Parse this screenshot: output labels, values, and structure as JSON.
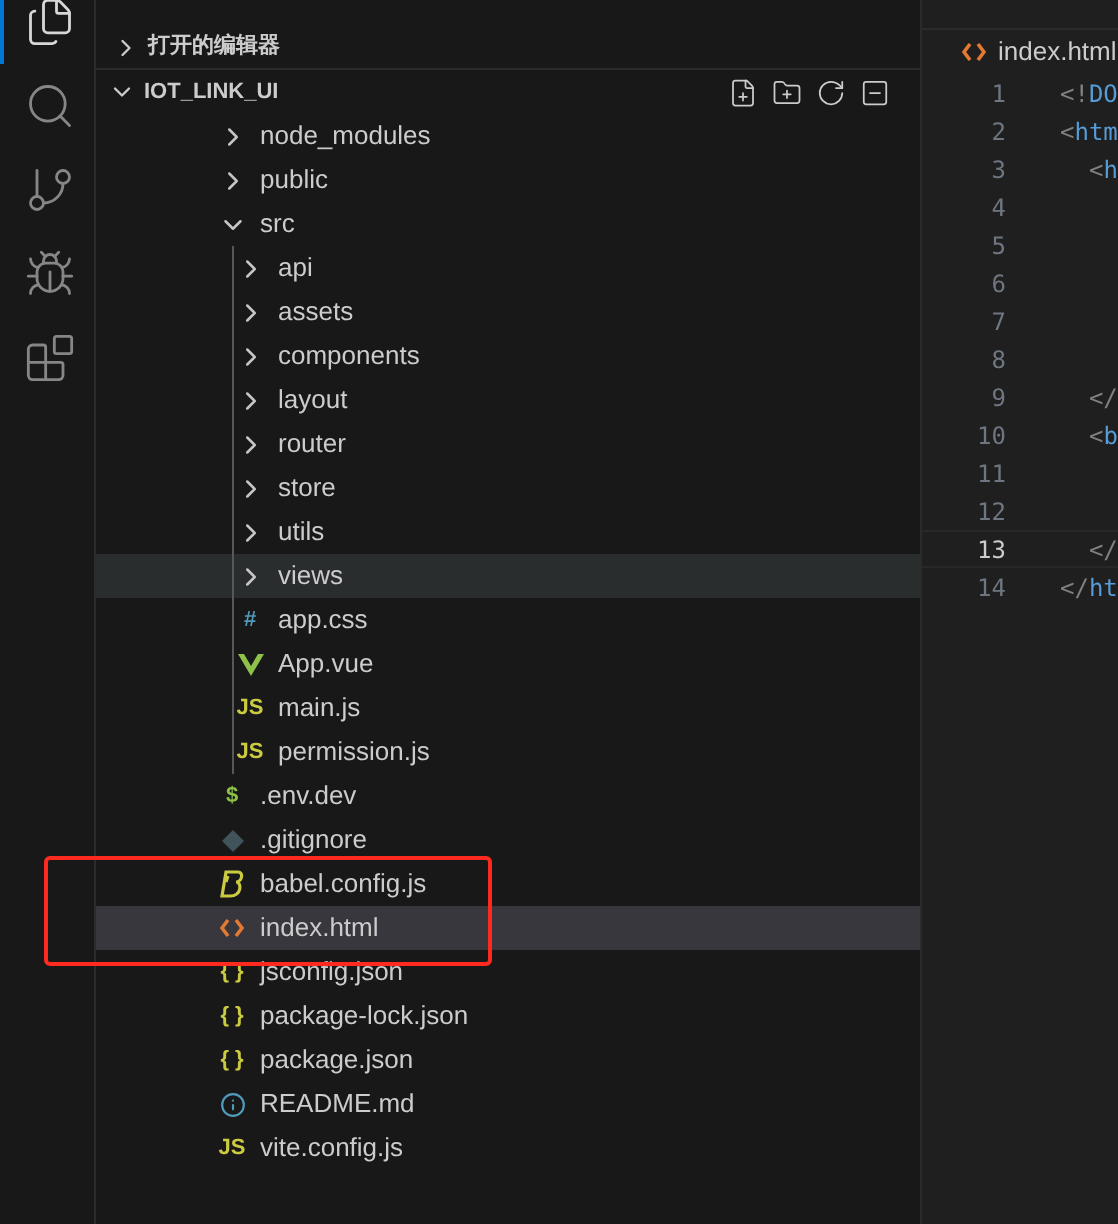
{
  "activity_bar": [
    {
      "kind": "files",
      "selected": true
    },
    {
      "kind": "search",
      "selected": false
    },
    {
      "kind": "source-control",
      "selected": false
    },
    {
      "kind": "run-debug",
      "selected": false
    },
    {
      "kind": "extensions",
      "selected": false
    }
  ],
  "open_editors": {
    "label": "打开的编辑器",
    "expanded": false
  },
  "explorer": {
    "title": "IOT_LINK_UI",
    "expanded": true,
    "actions": [
      {
        "kind": "new-file"
      },
      {
        "kind": "new-folder"
      },
      {
        "kind": "refresh"
      },
      {
        "kind": "collapse"
      }
    ],
    "items": [
      {
        "name": "node_modules",
        "kind": "folder",
        "expanded": false,
        "selected": false,
        "hovered": false
      },
      {
        "name": "public",
        "kind": "folder",
        "expanded": false,
        "selected": false,
        "hovered": false
      },
      {
        "name": "src",
        "kind": "folder",
        "expanded": true,
        "selected": false,
        "hovered": false,
        "children": [
          {
            "name": "api",
            "kind": "folder",
            "expanded": false,
            "selected": false,
            "hovered": false
          },
          {
            "name": "assets",
            "kind": "folder",
            "expanded": false,
            "selected": false,
            "hovered": false
          },
          {
            "name": "components",
            "kind": "folder",
            "expanded": false,
            "selected": false,
            "hovered": false
          },
          {
            "name": "layout",
            "kind": "folder",
            "expanded": false,
            "selected": false,
            "hovered": false
          },
          {
            "name": "router",
            "kind": "folder",
            "expanded": false,
            "selected": false,
            "hovered": false
          },
          {
            "name": "store",
            "kind": "folder",
            "expanded": false,
            "selected": false,
            "hovered": false
          },
          {
            "name": "utils",
            "kind": "folder",
            "expanded": false,
            "selected": false,
            "hovered": false
          },
          {
            "name": "views",
            "kind": "folder",
            "expanded": false,
            "selected": false,
            "hovered": true
          },
          {
            "name": "app.css",
            "kind": "css",
            "glyph": "#",
            "selected": false,
            "hovered": false
          },
          {
            "name": "App.vue",
            "kind": "vue",
            "selected": false,
            "hovered": false
          },
          {
            "name": "main.js",
            "kind": "js",
            "glyph": "JS",
            "selected": false,
            "hovered": false
          },
          {
            "name": "permission.js",
            "kind": "js",
            "glyph": "JS",
            "selected": false,
            "hovered": false
          }
        ]
      },
      {
        "name": ".env.dev",
        "kind": "env",
        "glyph": "$",
        "selected": false,
        "hovered": false
      },
      {
        "name": ".gitignore",
        "kind": "git",
        "selected": false,
        "hovered": false
      },
      {
        "name": "babel.config.js",
        "kind": "babel",
        "selected": false,
        "hovered": false
      },
      {
        "name": "index.html",
        "kind": "html",
        "selected": true,
        "hovered": false
      },
      {
        "name": "jsconfig.json",
        "kind": "json",
        "glyph": "{ }",
        "selected": false,
        "hovered": false
      },
      {
        "name": "package-lock.json",
        "kind": "json",
        "glyph": "{ }",
        "selected": false,
        "hovered": false
      },
      {
        "name": "package.json",
        "kind": "json",
        "glyph": "{ }",
        "selected": false,
        "hovered": false
      },
      {
        "name": "README.md",
        "kind": "info",
        "selected": false,
        "hovered": false
      },
      {
        "name": "vite.config.js",
        "kind": "js",
        "glyph": "JS",
        "selected": false,
        "hovered": false
      }
    ]
  },
  "annotations": [
    {
      "kind": "rectangle",
      "color": "#ff2a1f"
    }
  ],
  "editor": {
    "tab": {
      "label": "index.html",
      "kind": "html"
    },
    "lines": [
      {
        "number": "1",
        "punct": "<!",
        "tag": "DO",
        "current": false
      },
      {
        "number": "2",
        "punct": "<",
        "tag": "htm",
        "current": false
      },
      {
        "number": "3",
        "punct": "  <",
        "tag": "h",
        "current": false
      },
      {
        "number": "4",
        "current": false
      },
      {
        "number": "5",
        "current": false
      },
      {
        "number": "6",
        "current": false
      },
      {
        "number": "7",
        "current": false
      },
      {
        "number": "8",
        "current": false
      },
      {
        "number": "9",
        "punct": "  </",
        "current": false
      },
      {
        "number": "10",
        "punct": "  <",
        "tag": "b",
        "current": false
      },
      {
        "number": "11",
        "current": false
      },
      {
        "number": "12",
        "current": false
      },
      {
        "number": "13",
        "punct": "  </",
        "current": true
      },
      {
        "number": "14",
        "punct": "</",
        "tag": "ht",
        "current": false
      }
    ]
  }
}
